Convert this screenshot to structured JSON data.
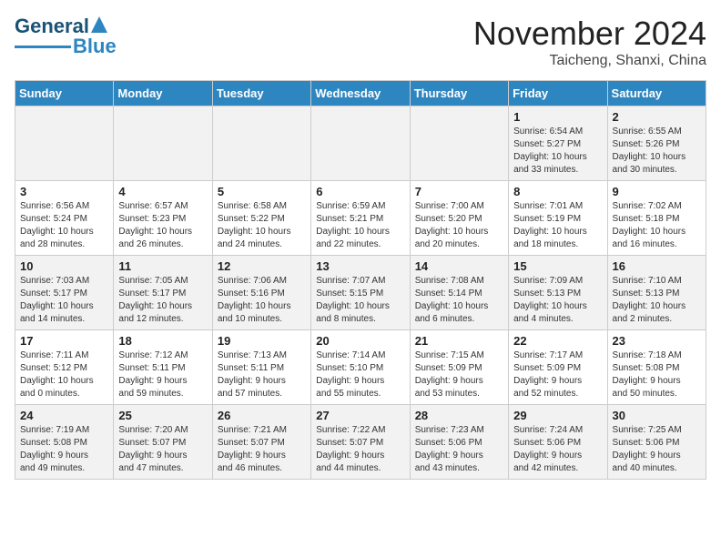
{
  "header": {
    "logo_line1": "General",
    "logo_line2": "Blue",
    "month": "November 2024",
    "location": "Taicheng, Shanxi, China"
  },
  "weekdays": [
    "Sunday",
    "Monday",
    "Tuesday",
    "Wednesday",
    "Thursday",
    "Friday",
    "Saturday"
  ],
  "weeks": [
    [
      {
        "day": "",
        "info": ""
      },
      {
        "day": "",
        "info": ""
      },
      {
        "day": "",
        "info": ""
      },
      {
        "day": "",
        "info": ""
      },
      {
        "day": "",
        "info": ""
      },
      {
        "day": "1",
        "info": "Sunrise: 6:54 AM\nSunset: 5:27 PM\nDaylight: 10 hours\nand 33 minutes."
      },
      {
        "day": "2",
        "info": "Sunrise: 6:55 AM\nSunset: 5:26 PM\nDaylight: 10 hours\nand 30 minutes."
      }
    ],
    [
      {
        "day": "3",
        "info": "Sunrise: 6:56 AM\nSunset: 5:24 PM\nDaylight: 10 hours\nand 28 minutes."
      },
      {
        "day": "4",
        "info": "Sunrise: 6:57 AM\nSunset: 5:23 PM\nDaylight: 10 hours\nand 26 minutes."
      },
      {
        "day": "5",
        "info": "Sunrise: 6:58 AM\nSunset: 5:22 PM\nDaylight: 10 hours\nand 24 minutes."
      },
      {
        "day": "6",
        "info": "Sunrise: 6:59 AM\nSunset: 5:21 PM\nDaylight: 10 hours\nand 22 minutes."
      },
      {
        "day": "7",
        "info": "Sunrise: 7:00 AM\nSunset: 5:20 PM\nDaylight: 10 hours\nand 20 minutes."
      },
      {
        "day": "8",
        "info": "Sunrise: 7:01 AM\nSunset: 5:19 PM\nDaylight: 10 hours\nand 18 minutes."
      },
      {
        "day": "9",
        "info": "Sunrise: 7:02 AM\nSunset: 5:18 PM\nDaylight: 10 hours\nand 16 minutes."
      }
    ],
    [
      {
        "day": "10",
        "info": "Sunrise: 7:03 AM\nSunset: 5:17 PM\nDaylight: 10 hours\nand 14 minutes."
      },
      {
        "day": "11",
        "info": "Sunrise: 7:05 AM\nSunset: 5:17 PM\nDaylight: 10 hours\nand 12 minutes."
      },
      {
        "day": "12",
        "info": "Sunrise: 7:06 AM\nSunset: 5:16 PM\nDaylight: 10 hours\nand 10 minutes."
      },
      {
        "day": "13",
        "info": "Sunrise: 7:07 AM\nSunset: 5:15 PM\nDaylight: 10 hours\nand 8 minutes."
      },
      {
        "day": "14",
        "info": "Sunrise: 7:08 AM\nSunset: 5:14 PM\nDaylight: 10 hours\nand 6 minutes."
      },
      {
        "day": "15",
        "info": "Sunrise: 7:09 AM\nSunset: 5:13 PM\nDaylight: 10 hours\nand 4 minutes."
      },
      {
        "day": "16",
        "info": "Sunrise: 7:10 AM\nSunset: 5:13 PM\nDaylight: 10 hours\nand 2 minutes."
      }
    ],
    [
      {
        "day": "17",
        "info": "Sunrise: 7:11 AM\nSunset: 5:12 PM\nDaylight: 10 hours\nand 0 minutes."
      },
      {
        "day": "18",
        "info": "Sunrise: 7:12 AM\nSunset: 5:11 PM\nDaylight: 9 hours\nand 59 minutes."
      },
      {
        "day": "19",
        "info": "Sunrise: 7:13 AM\nSunset: 5:11 PM\nDaylight: 9 hours\nand 57 minutes."
      },
      {
        "day": "20",
        "info": "Sunrise: 7:14 AM\nSunset: 5:10 PM\nDaylight: 9 hours\nand 55 minutes."
      },
      {
        "day": "21",
        "info": "Sunrise: 7:15 AM\nSunset: 5:09 PM\nDaylight: 9 hours\nand 53 minutes."
      },
      {
        "day": "22",
        "info": "Sunrise: 7:17 AM\nSunset: 5:09 PM\nDaylight: 9 hours\nand 52 minutes."
      },
      {
        "day": "23",
        "info": "Sunrise: 7:18 AM\nSunset: 5:08 PM\nDaylight: 9 hours\nand 50 minutes."
      }
    ],
    [
      {
        "day": "24",
        "info": "Sunrise: 7:19 AM\nSunset: 5:08 PM\nDaylight: 9 hours\nand 49 minutes."
      },
      {
        "day": "25",
        "info": "Sunrise: 7:20 AM\nSunset: 5:07 PM\nDaylight: 9 hours\nand 47 minutes."
      },
      {
        "day": "26",
        "info": "Sunrise: 7:21 AM\nSunset: 5:07 PM\nDaylight: 9 hours\nand 46 minutes."
      },
      {
        "day": "27",
        "info": "Sunrise: 7:22 AM\nSunset: 5:07 PM\nDaylight: 9 hours\nand 44 minutes."
      },
      {
        "day": "28",
        "info": "Sunrise: 7:23 AM\nSunset: 5:06 PM\nDaylight: 9 hours\nand 43 minutes."
      },
      {
        "day": "29",
        "info": "Sunrise: 7:24 AM\nSunset: 5:06 PM\nDaylight: 9 hours\nand 42 minutes."
      },
      {
        "day": "30",
        "info": "Sunrise: 7:25 AM\nSunset: 5:06 PM\nDaylight: 9 hours\nand 40 minutes."
      }
    ]
  ]
}
